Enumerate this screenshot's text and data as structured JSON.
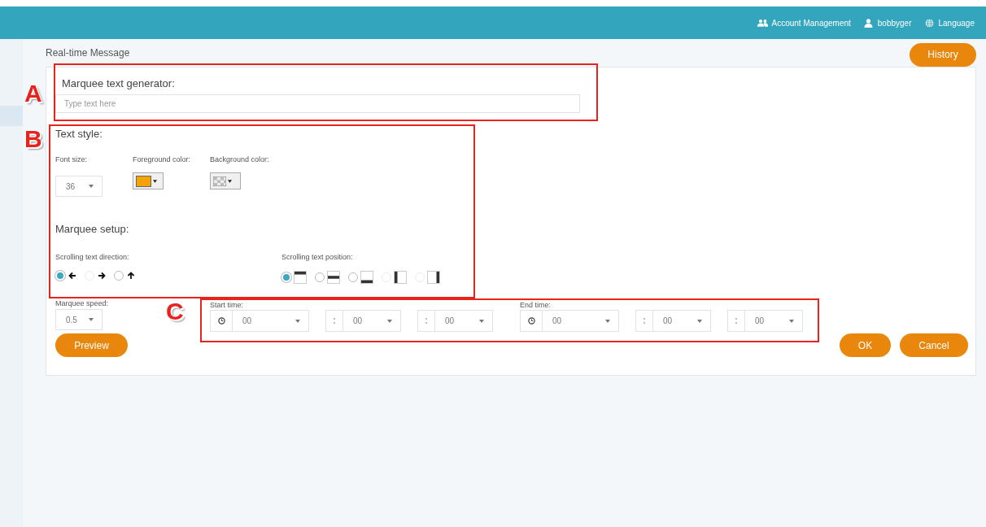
{
  "header": {
    "nav": [
      {
        "kind": "account",
        "label": "Account Management"
      },
      {
        "kind": "user",
        "label": "bobbyger"
      },
      {
        "kind": "language",
        "label": "Language"
      }
    ]
  },
  "page_title": "Real-time Message",
  "history_button": "History",
  "marquee_text": {
    "heading": "Marquee text generator:",
    "placeholder": "Type text here"
  },
  "text_style": {
    "heading": "Text style:",
    "font_size": {
      "label": "Font size:",
      "value": "36"
    },
    "foreground": {
      "label": "Foreground color:",
      "color": "#f5a300"
    },
    "background": {
      "label": "Background color:"
    }
  },
  "marquee_setup": {
    "heading": "Marquee setup:",
    "direction": {
      "label": "Scrolling text direction:",
      "options": [
        {
          "kind": "left",
          "selected": true,
          "disabled": false
        },
        {
          "kind": "right",
          "selected": false,
          "disabled": true
        },
        {
          "kind": "up",
          "selected": false,
          "disabled": false
        }
      ]
    },
    "position": {
      "label": "Scrolling text position:",
      "options": [
        {
          "kind": "top",
          "selected": true,
          "disabled": false
        },
        {
          "kind": "middle",
          "selected": false,
          "disabled": false
        },
        {
          "kind": "bottom",
          "selected": false,
          "disabled": false
        },
        {
          "kind": "left",
          "selected": false,
          "disabled": true
        },
        {
          "kind": "right",
          "selected": false,
          "disabled": true
        }
      ]
    }
  },
  "speed": {
    "label": "Marquee speed:",
    "value": "0.5"
  },
  "start_time": {
    "label": "Start time:",
    "fields": [
      "00",
      "00",
      "00"
    ]
  },
  "end_time": {
    "label": "End time:",
    "fields": [
      "00",
      "00",
      "00"
    ]
  },
  "buttons": {
    "preview": "Preview",
    "ok": "OK",
    "cancel": "Cancel"
  },
  "annotations": [
    {
      "label": "A"
    },
    {
      "label": "B"
    },
    {
      "label": "C"
    }
  ]
}
